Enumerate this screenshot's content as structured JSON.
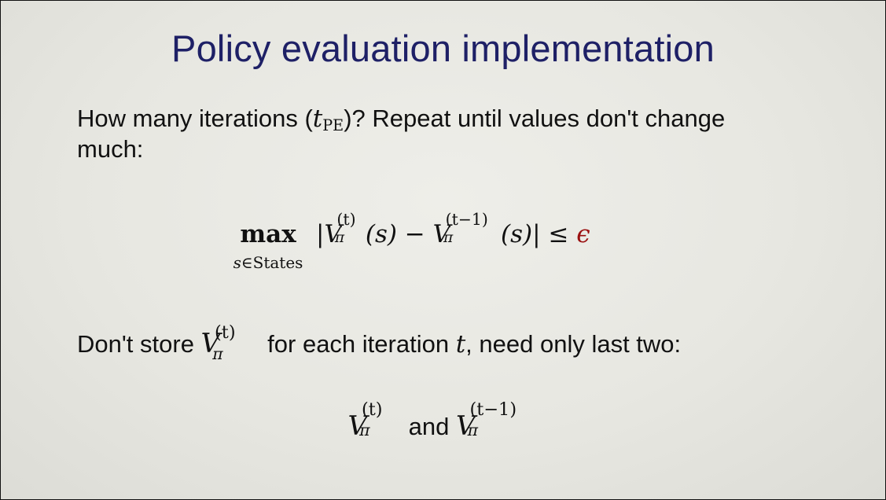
{
  "slide": {
    "title": "Policy evaluation implementation",
    "para1": {
      "lead": "How many iterations (",
      "t_symbol": "t",
      "t_sub": "PE",
      "tail": ")? Repeat until values don't change",
      "line2": "much:"
    },
    "formula": {
      "max": "max",
      "max_sub_var": "s",
      "max_sub_rest": "∈States",
      "open_abs": "|",
      "V": "V",
      "pi": "π",
      "sup_t": "(t)",
      "sup_t1": "(t−1)",
      "arg1": "(s)",
      "minus": " − ",
      "arg2": "(s)",
      "close_abs": "|",
      "leq": " ≤ ",
      "epsilon": "ϵ"
    },
    "para2": {
      "lead": "Don't store ",
      "middle": " for each iteration ",
      "t_symbol": "t",
      "tail": ", need only last two:"
    },
    "final": {
      "and": " and "
    }
  }
}
